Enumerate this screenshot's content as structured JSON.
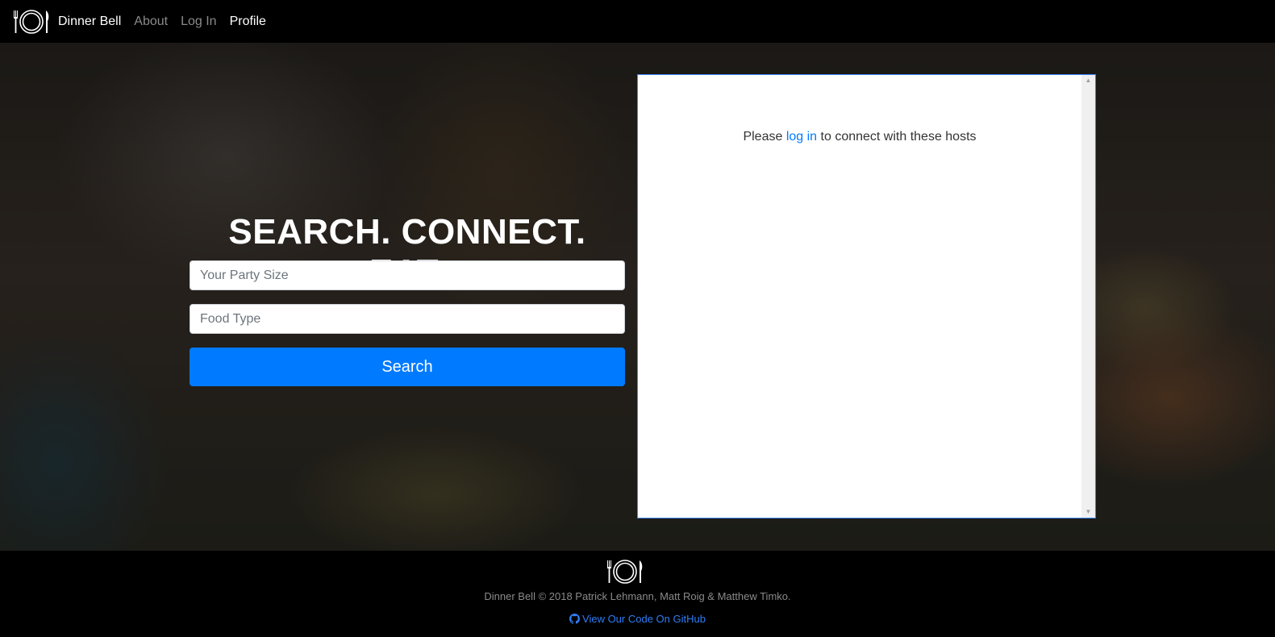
{
  "nav": {
    "brand": "Dinner Bell",
    "links": [
      {
        "label": "About"
      },
      {
        "label": "Log In"
      },
      {
        "label": "Profile"
      }
    ]
  },
  "hero": {
    "title": "SEARCH. CONNECT. EAT.",
    "party_size_placeholder": "Your Party Size",
    "food_type_placeholder": "Food Type",
    "search_label": "Search"
  },
  "panel": {
    "msg_before": "Please ",
    "msg_link": "log in",
    "msg_after": " to connect with these hosts"
  },
  "footer": {
    "copyright": "Dinner Bell © 2018 Patrick Lehmann, Matt Roig & Matthew Timko.",
    "github_link": "View Our Code On GitHub"
  },
  "colors": {
    "accent": "#007bff",
    "nav_bg": "#000000",
    "muted_text": "#8a8a8a"
  },
  "icons": [
    "plate-fork-knife-icon",
    "github-icon",
    "scroll-up-icon",
    "scroll-down-icon"
  ]
}
